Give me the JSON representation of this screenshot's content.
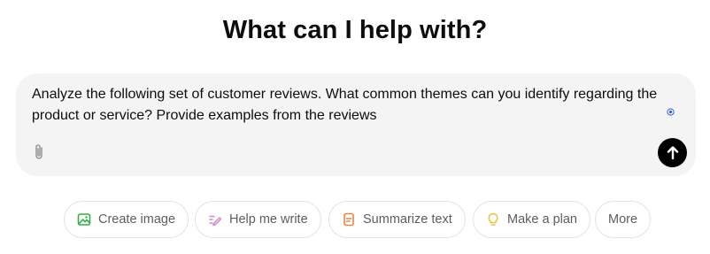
{
  "heading": "What can I help with?",
  "composer": {
    "prompt_text": "Analyze the following set of customer reviews. What common themes can you identify regarding the product or service? Provide examples from the reviews"
  },
  "suggestions": [
    {
      "label": "Create image",
      "icon": "image-icon",
      "color": "#35ae47"
    },
    {
      "label": "Help me write",
      "icon": "pen-icon",
      "color": "#cb8bd0"
    },
    {
      "label": "Summarize text",
      "icon": "document-icon",
      "color": "#ea8444"
    },
    {
      "label": "Make a plan",
      "icon": "lightbulb-icon",
      "color": "#e2c541"
    },
    {
      "label": "More",
      "icon": "",
      "color": "#5d5d5d"
    }
  ],
  "colors": {
    "composer_bg": "#f4f4f4",
    "send_button": "#000000",
    "grammar_indicator": "#3b5bdb"
  }
}
